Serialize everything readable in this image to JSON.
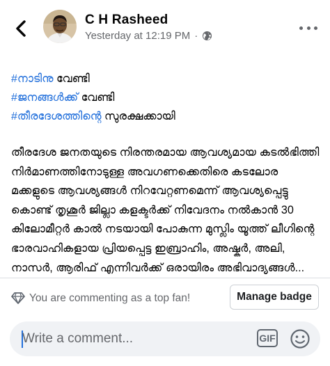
{
  "header": {
    "author_name": "C H Rasheed",
    "timestamp": "Yesterday at 12:19 PM",
    "separator": "·",
    "icons": {
      "back": "back-arrow-icon",
      "privacy": "globe-icon",
      "more": "more-options-icon"
    }
  },
  "post": {
    "hashtags": [
      {
        "tag": "#നാടിനു",
        "text": " വേണ്ടി"
      },
      {
        "tag": "#ജനങ്ങൾക്ക്",
        "text": " വേണ്ടി"
      },
      {
        "tag": "#തീരദേശത്തിന്റെ",
        "text": " സുരക്ഷക്കായി"
      }
    ],
    "body": "തീരദേശ ജനതയുടെ നിരന്തരമായ ആവശ്യമായ കടൽഭിത്തി നിർമാണത്തിനോടുള്ള അവഗണക്കെതിരെ കടലോര മക്കളുടെ ആവശ്യങ്ങൾ നിറവേറ്റണമെന്ന്  ആവശ്യപ്പെട്ടു കൊണ്ട് തൃശൂർ ജില്ലാ കളക്ടർക്ക് നിവേദനം നൽകാൻ 30 കിലോമീറ്റർ കാൽ നടയായി പോകുന്ന മുസ്ലിം യൂത്ത് ലീഗിന്റെ ഭാരവാഹികളായ പ്രിയപ്പെട്ട ഇബ്രാഹിം, അഷ്കർ, അലി, നാസർ, ആരിഫ് എന്നിവർക്ക് ഒരായിരം അഭിവാദ്യങ്ങൾ..."
  },
  "fan_row": {
    "message": "You are commenting as a top fan!",
    "button_label": "Manage badge",
    "icon": "diamond-badge-icon"
  },
  "comment_bar": {
    "placeholder": "Write a comment...",
    "gif_label": "GIF",
    "emoji_icon": "smiley-icon"
  },
  "colors": {
    "hashtag": "#216fdb",
    "secondary_text": "#65676b",
    "comment_bg": "#f0f2f5"
  }
}
